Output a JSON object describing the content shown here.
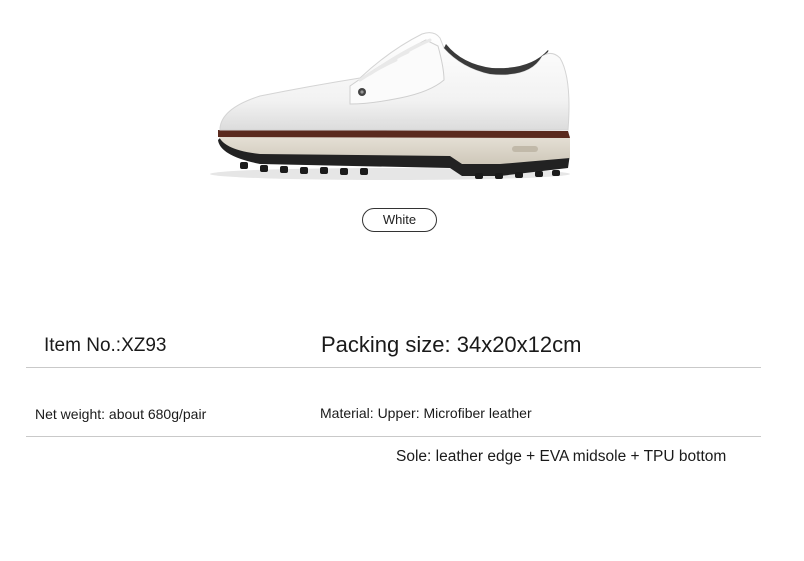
{
  "product": {
    "image_name": "white-golf-shoe",
    "color_option": "White"
  },
  "specs": {
    "item_no": "Item No.:XZ93",
    "packing_size": "Packing size: 34x20x12cm",
    "net_weight": "Net weight: about 680g/pair",
    "material": "Material: Upper: Microfiber leather",
    "sole": "Sole: leather edge + EVA midsole + TPU bottom"
  }
}
